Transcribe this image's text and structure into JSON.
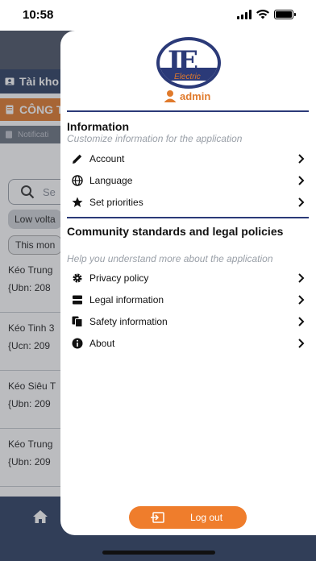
{
  "status_bar": {
    "time": "10:58"
  },
  "background": {
    "account_label": "Tài kho",
    "cong_label": "CÔNG T",
    "notif_label": "Notificati",
    "search_placeholder": "Se",
    "chip_low": "Low volta",
    "chip_month": "This mon",
    "items": [
      {
        "title": "Kéo Trung",
        "code": "{Ubn: 208"
      },
      {
        "title": "Kéo Tinh 3",
        "code": "{Ucn: 209"
      },
      {
        "title": "Kéo Siêu T",
        "code": "{Ubn: 209"
      },
      {
        "title": "Kéo Trung",
        "code": "{Ubn: 209"
      }
    ]
  },
  "drawer": {
    "logo_text": "Electric",
    "username": "admin",
    "information": {
      "title": "Information",
      "subtitle": "Customize information for the application",
      "items": [
        {
          "label": "Account",
          "icon": "pencil-icon"
        },
        {
          "label": "Language",
          "icon": "globe-icon"
        },
        {
          "label": "Set priorities",
          "icon": "star-icon"
        }
      ]
    },
    "community": {
      "title": "Community standards and legal policies",
      "subtitle": "Help you understand more about the application",
      "items": [
        {
          "label": "Privacy policy",
          "icon": "gear-icon"
        },
        {
          "label": "Legal information",
          "icon": "storage-icon"
        },
        {
          "label": "Safety information",
          "icon": "documents-icon"
        },
        {
          "label": "About",
          "icon": "info-icon"
        }
      ]
    },
    "logout_label": "Log out"
  },
  "colors": {
    "accent": "#ef7d2c",
    "brand_navy": "#2b3a78"
  }
}
